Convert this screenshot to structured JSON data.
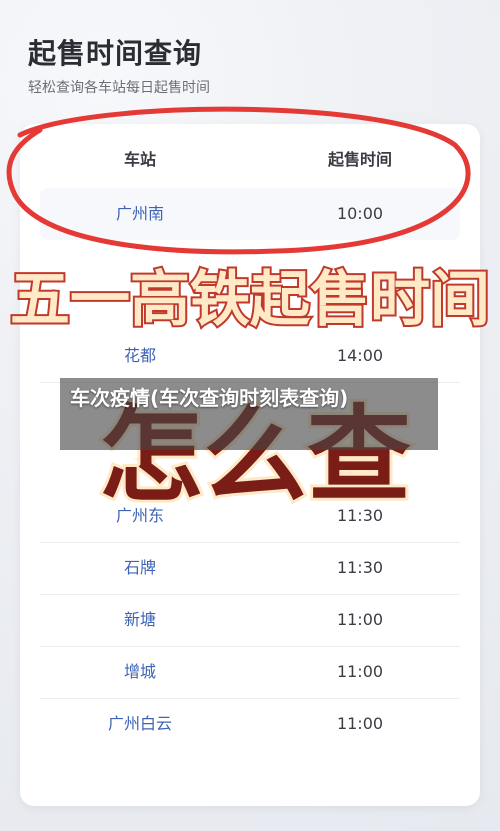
{
  "page": {
    "title": "起售时间查询",
    "subtitle": "轻松查询各车站每日起售时间"
  },
  "table": {
    "headers": {
      "station": "车站",
      "time": "起售时间"
    },
    "rows": [
      {
        "station": "广州南",
        "time": "10:00"
      },
      {
        "station": "花都",
        "time": "14:00"
      },
      {
        "station": "广州东",
        "time": "11:30"
      },
      {
        "station": "石牌",
        "time": "11:30"
      },
      {
        "station": "新塘",
        "time": "11:00"
      },
      {
        "station": "增城",
        "time": "11:00"
      },
      {
        "station": "广州白云",
        "time": "11:00"
      }
    ]
  },
  "banner": {
    "text": "五一高铁起售时间",
    "big_text": "怎么查",
    "fill_color": "#ffe9c7",
    "outline_color": "#c0392b"
  },
  "overlay": {
    "caption": "车次疫情(车次查询时刻表查询)"
  },
  "annotation": {
    "circle_color": "#e53935"
  }
}
